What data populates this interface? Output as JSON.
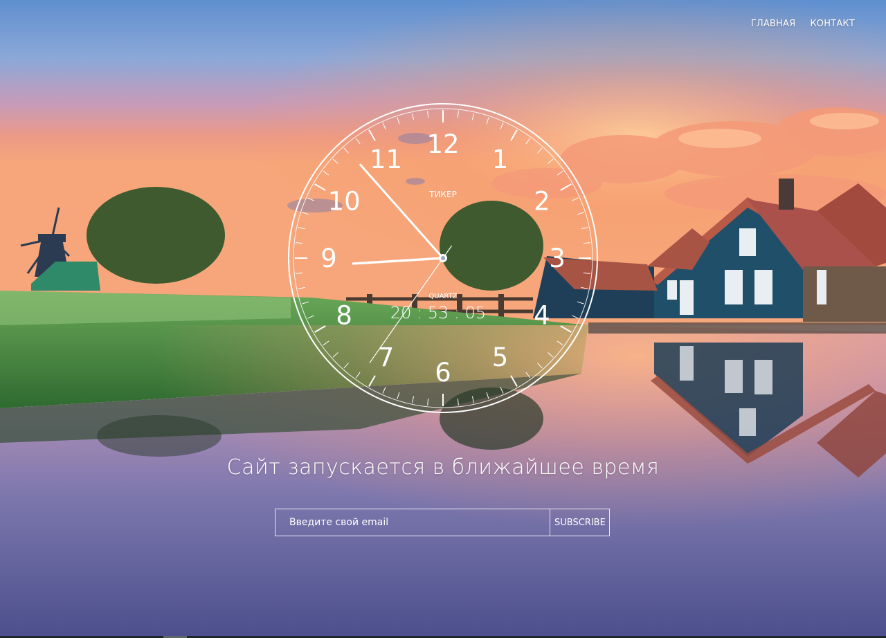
{
  "nav": {
    "home": "ГЛАВНАЯ",
    "contact": "КОНТАКТ"
  },
  "clock": {
    "brand": "ТИКЕР",
    "subbrand": "QUARTZ",
    "digital_time": "20 : 53 : 05",
    "numerals": [
      "12",
      "1",
      "2",
      "3",
      "4",
      "5",
      "6",
      "7",
      "8",
      "9",
      "10",
      "11"
    ],
    "hours": 20,
    "minutes": 53,
    "seconds": 5
  },
  "headline": "Сайт запускается в ближайшее время",
  "subscribe": {
    "placeholder": "Введите свой email",
    "button": "SUBSCRIBE"
  }
}
